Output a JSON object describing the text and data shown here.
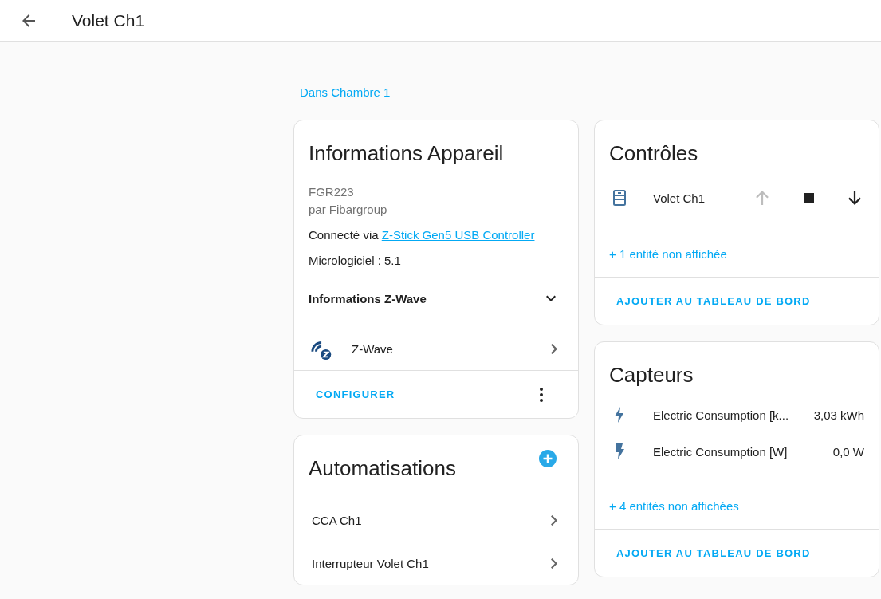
{
  "header": {
    "title": "Volet Ch1"
  },
  "area_link": "Dans Chambre 1",
  "device_info": {
    "title": "Informations Appareil",
    "model": "FGR223",
    "manufacturer": "par Fibargroup",
    "connected_prefix": "Connecté via",
    "connected_link": "Z-Stick Gen5 USB Controller",
    "firmware": "Micrologiciel : 5.1",
    "zwave_section": {
      "label": "Informations Z-Wave",
      "expanded": false
    },
    "integration": "Z-Wave",
    "action": "CONFIGURER"
  },
  "automations": {
    "title": "Automatisations",
    "items": [
      "CCA Ch1",
      "Interrupteur Volet Ch1"
    ]
  },
  "controls": {
    "title": "Contrôles",
    "entity": "Volet Ch1",
    "buttons": [
      {
        "kind": "up",
        "disabled": true
      },
      {
        "kind": "stop",
        "disabled": false
      },
      {
        "kind": "down",
        "disabled": false
      }
    ],
    "hidden": "+ 1 entité non affichée",
    "action": "AJOUTER AU TABLEAU DE BORD"
  },
  "sensors": {
    "title": "Capteurs",
    "items": [
      {
        "kind": "energy",
        "name": "Electric Consumption [k...",
        "value": "3,03 kWh"
      },
      {
        "kind": "power",
        "name": "Electric Consumption [W]",
        "value": "0,0 W"
      }
    ],
    "hidden": "+ 4 entités non affichées",
    "action": "AJOUTER AU TABLEAU DE BORD"
  }
}
